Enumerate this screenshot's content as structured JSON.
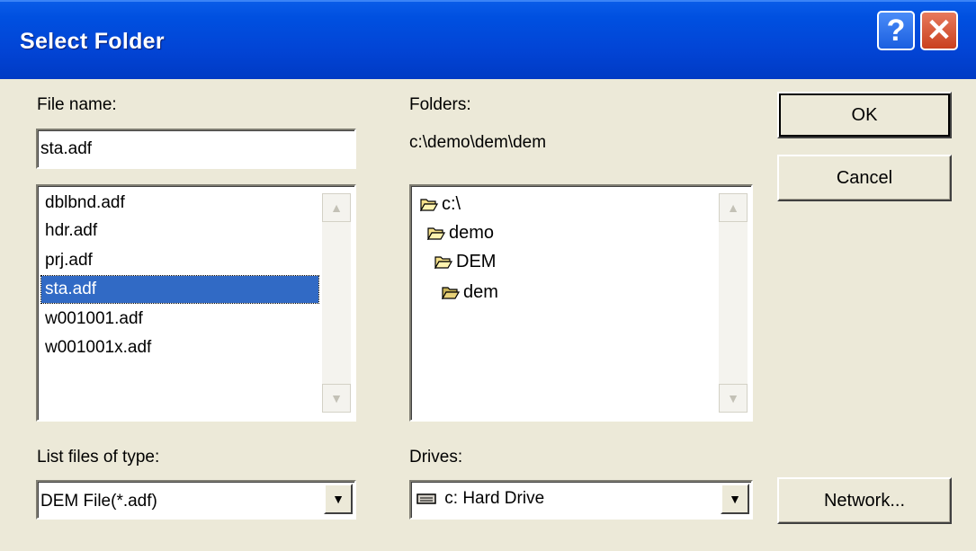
{
  "window": {
    "title": "Select Folder",
    "help_label": "?",
    "close_label": "✕"
  },
  "file_name": {
    "label": "File name:",
    "value": "sta.adf"
  },
  "files": {
    "items": [
      "dblbnd.adf",
      "hdr.adf",
      "prj.adf",
      "sta.adf",
      "w001001.adf",
      "w001001x.adf"
    ],
    "selected": "sta.adf"
  },
  "folders": {
    "label": "Folders:",
    "current_path": "c:\\demo\\dem\\dem",
    "items": [
      "c:\\",
      "demo",
      "DEM",
      "dem"
    ]
  },
  "file_type": {
    "label": "List files of type:",
    "value": "DEM File(*.adf)"
  },
  "drives": {
    "label": "Drives:",
    "value": "c: Hard Drive"
  },
  "buttons": {
    "ok": "OK",
    "cancel": "Cancel",
    "network": "Network..."
  },
  "icons": {
    "help": "question-icon",
    "close": "close-icon",
    "scroll_up": "scroll-up-icon",
    "scroll_down": "scroll-down-icon",
    "folder_open": "folder-open-icon",
    "drive": "hard-drive-icon",
    "dropdown": "dropdown-arrow-icon"
  },
  "colors": {
    "title_bar": "#0245d6",
    "selection": "#316ac5",
    "close_button": "#c9401f",
    "face": "#ece9d8"
  }
}
